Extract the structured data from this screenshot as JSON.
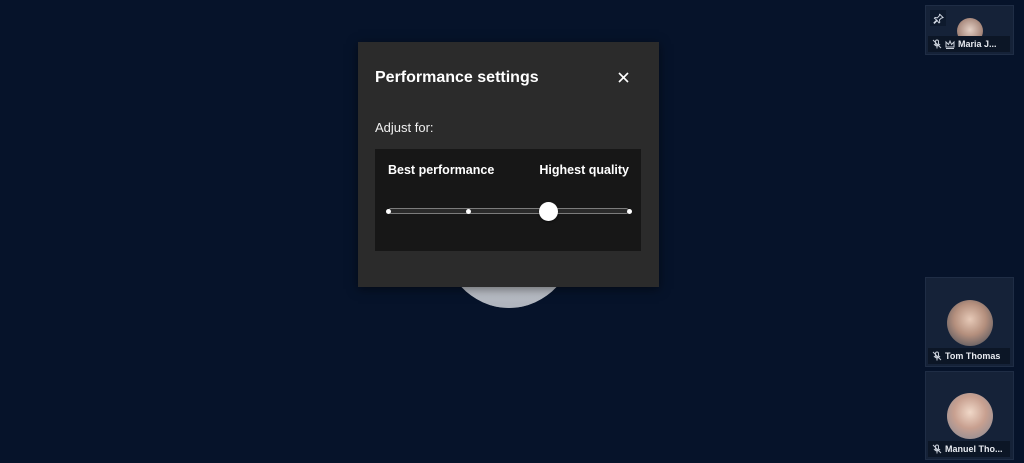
{
  "dialog": {
    "title": "Performance settings",
    "adjust_label": "Adjust for:",
    "slider": {
      "left_label": "Best performance",
      "right_label": "Highest quality",
      "stops": 4,
      "selected_stop": 3
    }
  },
  "participants": [
    {
      "name": "Maria J...",
      "muted": true,
      "host_crown": true,
      "pinned": true
    },
    {
      "name": "Tom Thomas",
      "muted": true
    },
    {
      "name": "Manuel Tho...",
      "muted": true
    }
  ],
  "colors": {
    "background": "#06132a",
    "dialog": "#2b2b2b",
    "slider_panel": "#171717",
    "tile": "#152238"
  }
}
